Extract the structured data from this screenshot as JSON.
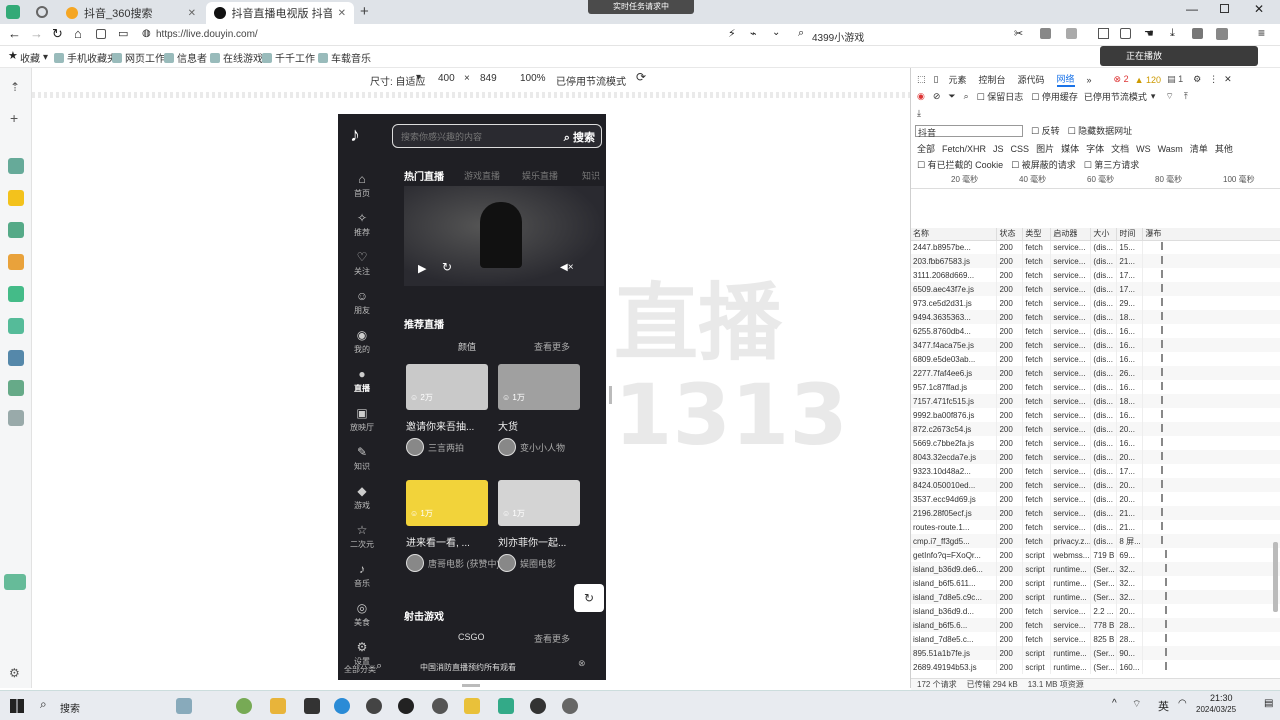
{
  "tabs": [
    {
      "label": "抖音_360搜索",
      "active": false
    },
    {
      "label": "抖音直播电视版 抖音直播PC",
      "active": true
    }
  ],
  "popup": "实时任务请求中",
  "address": {
    "url": "https://live.douyin.com/",
    "search_placeholder": "4399小游戏"
  },
  "bookmarks": [
    "收藏",
    "手机收藏夹",
    "网页工作",
    "信息者",
    "在线游戏",
    "千千工作",
    "车载音乐"
  ],
  "notification": "正在播放",
  "device_toolbar": {
    "dimensions": "尺寸: 自适应",
    "width": "400",
    "height": "849",
    "zoom": "100%",
    "throttle": "已停用节流模式"
  },
  "phone": {
    "search_placeholder": "搜索你感兴趣的内容",
    "search_button": "搜索",
    "nav": [
      {
        "label": "首页",
        "glyph": "⌂"
      },
      {
        "label": "推荐",
        "glyph": "✧"
      },
      {
        "label": "关注",
        "glyph": "♡"
      },
      {
        "label": "朋友",
        "glyph": "☺"
      },
      {
        "label": "我的",
        "glyph": "◉"
      },
      {
        "label": "直播",
        "glyph": "●"
      },
      {
        "label": "放映厅",
        "glyph": "▣"
      },
      {
        "label": "知识",
        "glyph": "✎"
      },
      {
        "label": "游戏",
        "glyph": "◆"
      },
      {
        "label": "二次元",
        "glyph": "☆"
      },
      {
        "label": "音乐",
        "glyph": "♪"
      },
      {
        "label": "美食",
        "glyph": "◎"
      },
      {
        "label": "设置",
        "glyph": "⚙"
      }
    ],
    "hot_live": {
      "title": "热门直播",
      "tabs": [
        "热门直播",
        "游戏直播",
        "娱乐直播",
        "知识"
      ]
    },
    "recommend": {
      "title": "推荐直播",
      "tab_left": "颜值",
      "tab_right": "查看更多"
    },
    "cards": [
      {
        "viewers": "2万",
        "title": "邀请你来吾抽...",
        "user": "三言两拍",
        "color": "#c9c9c9"
      },
      {
        "viewers": "1万",
        "title": "大货",
        "user": "变小小人物",
        "color": "#a0a0a0"
      },
      {
        "viewers": "1万",
        "title": "进来看一看, ...",
        "user": "唐哥电影 (获赞中)",
        "color": "#f2d33a"
      },
      {
        "viewers": "1万",
        "title": "刘亦菲你一起...",
        "user": "娱圈电影",
        "color": "#d4d4d4"
      }
    ],
    "games": {
      "title": "射击游戏",
      "tab": "CSGO",
      "more": "查看更多"
    },
    "bottom_text": "中国消防直播预约所有观看",
    "bottom_left": "全部分类"
  },
  "watermark": {
    "line1": "直播",
    "line2": "1313"
  },
  "devtools": {
    "tabs": [
      "元素",
      "控制台",
      "源代码",
      "网络"
    ],
    "counts": {
      "errors": "2",
      "warnings": "120",
      "info": "1"
    },
    "filter_value": "抖音",
    "preserve_log": "停用缓存",
    "throttle": "已停用节流模式",
    "disable_cache_label": "保留日志",
    "invert": "反转",
    "hide_data_urls": "隐藏数据网址",
    "type_filters": [
      "全部",
      "Fetch/XHR",
      "JS",
      "CSS",
      "图片",
      "媒体",
      "字体",
      "文档",
      "WS",
      "Wasm",
      "清单",
      "其他"
    ],
    "extra_filters": [
      "有已拦截的 Cookie",
      "被屏蔽的请求",
      "第三方请求"
    ],
    "timeline_ticks": [
      "20 毫秒",
      "40 毫秒",
      "60 毫秒",
      "80 毫秒",
      "100 毫秒"
    ],
    "columns": [
      "名称",
      "状态",
      "类型",
      "启动器",
      "大小",
      "时间",
      "瀑布"
    ],
    "rows": [
      [
        "2447.b8957be...",
        "200",
        "fetch",
        "service...",
        "(dis...",
        "15..."
      ],
      [
        "203.fbb67583.js",
        "200",
        "fetch",
        "service...",
        "(dis...",
        "21..."
      ],
      [
        "3111.2068d669...",
        "200",
        "fetch",
        "service...",
        "(dis...",
        "17..."
      ],
      [
        "6509.aec43f7e.js",
        "200",
        "fetch",
        "service...",
        "(dis...",
        "17..."
      ],
      [
        "973.ce5d2d31.js",
        "200",
        "fetch",
        "service...",
        "(dis...",
        "29..."
      ],
      [
        "9494.3635363...",
        "200",
        "fetch",
        "service...",
        "(dis...",
        "18..."
      ],
      [
        "6255.8760db4...",
        "200",
        "fetch",
        "service...",
        "(dis...",
        "16..."
      ],
      [
        "3477.f4aca75e.js",
        "200",
        "fetch",
        "service...",
        "(dis...",
        "16..."
      ],
      [
        "6809.e5de03ab...",
        "200",
        "fetch",
        "service...",
        "(dis...",
        "16..."
      ],
      [
        "2277.7faf4ee6.js",
        "200",
        "fetch",
        "service...",
        "(dis...",
        "26..."
      ],
      [
        "957.1c87ffad.js",
        "200",
        "fetch",
        "service...",
        "(dis...",
        "16..."
      ],
      [
        "7157.471fc515.js",
        "200",
        "fetch",
        "service...",
        "(dis...",
        "18..."
      ],
      [
        "9992.ba00f876.js",
        "200",
        "fetch",
        "service...",
        "(dis...",
        "16..."
      ],
      [
        "872.c2673c54.js",
        "200",
        "fetch",
        "service...",
        "(dis...",
        "20..."
      ],
      [
        "5669.c7bbe2fa.js",
        "200",
        "fetch",
        "service...",
        "(dis...",
        "16..."
      ],
      [
        "8043.32ecda7e.js",
        "200",
        "fetch",
        "service...",
        "(dis...",
        "20..."
      ],
      [
        "9323.10d48a2...",
        "200",
        "fetch",
        "service...",
        "(dis...",
        "17..."
      ],
      [
        "8424.050010ed...",
        "200",
        "fetch",
        "service...",
        "(dis...",
        "20..."
      ],
      [
        "3537.ecc94d69.js",
        "200",
        "fetch",
        "service...",
        "(dis...",
        "20..."
      ],
      [
        "2196.28f05ecf.js",
        "200",
        "fetch",
        "service...",
        "(dis...",
        "21..."
      ],
      [
        "routes-route.1...",
        "200",
        "fetch",
        "service...",
        "(dis...",
        "21..."
      ],
      [
        "cmp.i7_ff3gd5...",
        "200",
        "fetch",
        "privacy.z...",
        "(dis...",
        "8 屏..."
      ],
      [
        "getInfo?q=FXoQr...",
        "200",
        "script",
        "webmss...",
        "719 B",
        "69..."
      ],
      [
        "island_b36d9.de6...",
        "200",
        "script",
        "runtime...",
        "(Ser...",
        "32..."
      ],
      [
        "island_b6f5.611...",
        "200",
        "script",
        "runtime...",
        "(Ser...",
        "32..."
      ],
      [
        "island_7d8e5.c9c...",
        "200",
        "script",
        "runtime...",
        "(Ser...",
        "32..."
      ],
      [
        "island_b36d9.d...",
        "200",
        "fetch",
        "service...",
        "2.2 ...",
        "20..."
      ],
      [
        "island_b6f5.6...",
        "200",
        "fetch",
        "service...",
        "778 B",
        "28..."
      ],
      [
        "island_7d8e5.c...",
        "200",
        "fetch",
        "service...",
        "825 B",
        "28..."
      ],
      [
        "895.51a1b7fe.js",
        "200",
        "script",
        "runtime...",
        "(Ser...",
        "90..."
      ],
      [
        "2689.49194b53.js",
        "200",
        "script",
        "runtime...",
        "(Ser...",
        "160..."
      ]
    ],
    "status": {
      "requests": "172 个请求",
      "transferred": "已传输 294 kB",
      "resources": "13.1 MB 项资源"
    }
  },
  "taskbar": {
    "search": "搜索",
    "time": "21:30",
    "date": "2024/03/25",
    "lang": "英"
  }
}
